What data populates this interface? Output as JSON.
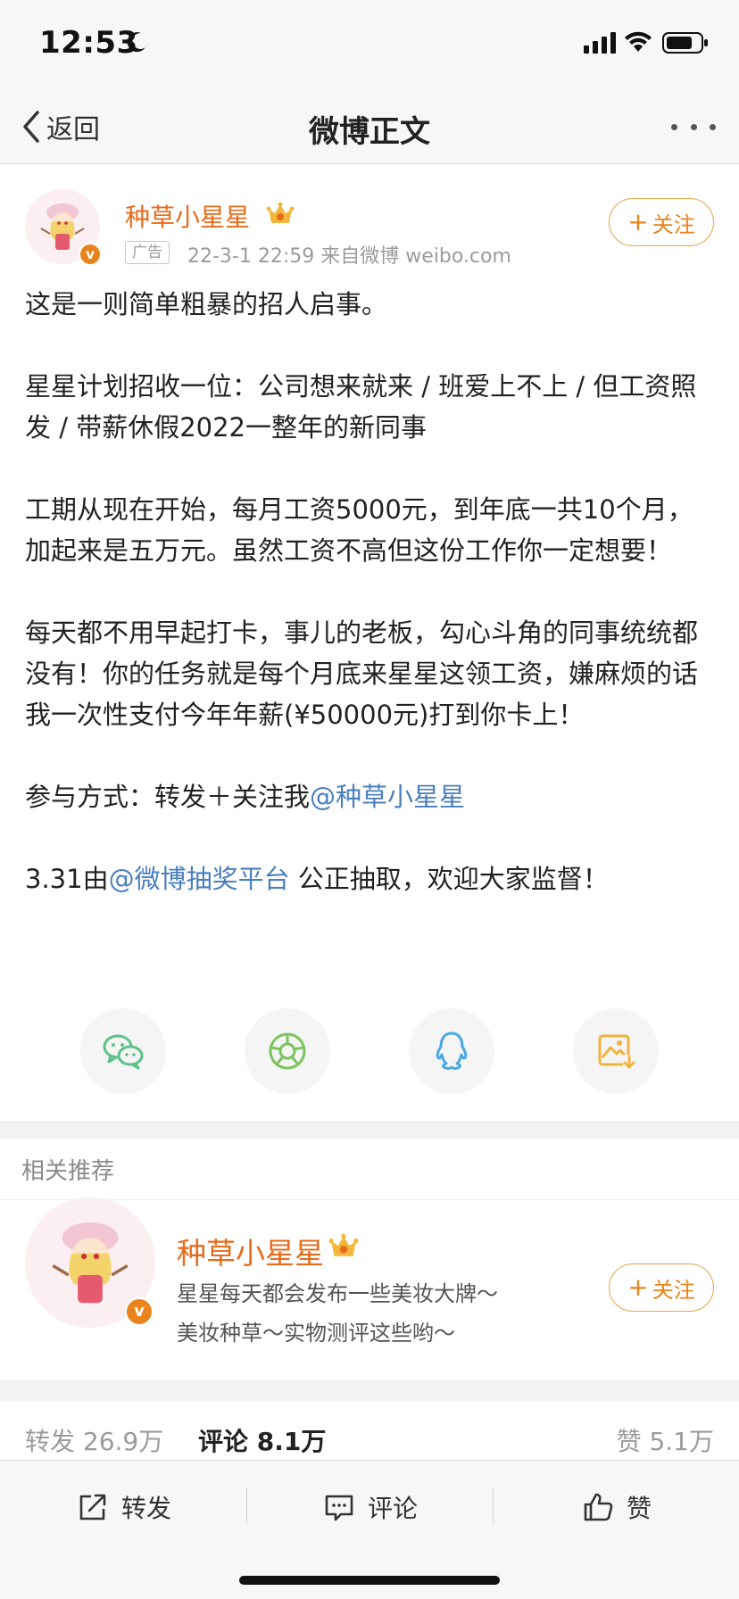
{
  "status_bar": {
    "time": "12:53",
    "icons": [
      "moon-icon",
      "signal-icon",
      "wifi-icon",
      "battery-icon"
    ]
  },
  "nav": {
    "back_label": "返回",
    "title": "微博正文"
  },
  "post": {
    "author": "种草小星星",
    "ad_tag": "广告",
    "meta": "22-3-1 22:59  来自微博 weibo.com",
    "follow_label": "关注",
    "paragraphs": {
      "p1": "这是一则简单粗暴的招人启事。",
      "p2": "星星计划招收一位：公司想来就来 / 班爱上不上 / 但工资照发 / 带薪休假2022一整年的新同事",
      "p3": "工期从现在开始，每月工资5000元，到年底一共10个月，加起来是五万元。虽然工资不高但这份工作你一定想要！",
      "p4": "每天都不用早起打卡，事儿的老板，勾心斗角的同事统统都没有！你的任务就是每个月底来星星这领工资，嫌麻烦的话我一次性支付今年年薪(¥50000元)打到你卡上！",
      "p5_prefix": "参与方式：转发＋关注我",
      "p5_mention": "@种草小星星",
      "p6_prefix": "3.31由",
      "p6_mention": "@微博抽奖平台",
      "p6_suffix": " 公正抽取，欢迎大家监督！"
    }
  },
  "share": {
    "icons": [
      "wechat-icon",
      "moments-icon",
      "qq-icon",
      "save-image-icon"
    ]
  },
  "related": {
    "section_label": "相关推荐",
    "name": "种草小星星",
    "desc_line1": "星星每天都会发布一些美妆大牌～",
    "desc_line2": "美妆种草～实物测评这些哟～",
    "follow_label": "关注"
  },
  "stats": {
    "repost": "转发 26.9万",
    "comment": "评论 8.1万",
    "like": "赞 5.1万"
  },
  "actions": {
    "repost": "转发",
    "comment": "评论",
    "like": "赞"
  },
  "colors": {
    "accent_orange": "#e8841b",
    "author_name": "#e86b1a",
    "mention_blue": "#4a7fbd",
    "wechat_green": "#5cc28a",
    "qq_blue": "#4aa8e0",
    "save_yellow": "#f0b43c"
  }
}
